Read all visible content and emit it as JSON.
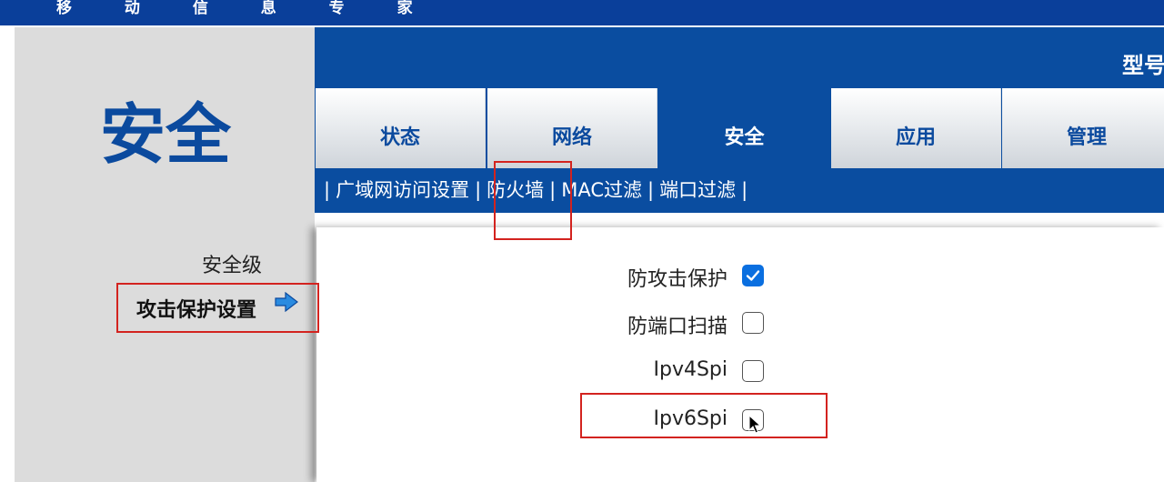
{
  "header": {
    "slogan": "移 动 信 息 专 家",
    "page_title": "安全",
    "model_label": "型号"
  },
  "tabs": [
    {
      "label": "状态",
      "active": false
    },
    {
      "label": "网络",
      "active": false
    },
    {
      "label": "安全",
      "active": true
    },
    {
      "label": "应用",
      "active": false
    },
    {
      "label": "管理",
      "active": false
    }
  ],
  "subnav": {
    "separator": "|",
    "items": [
      "广域网访问设置",
      "防火墙",
      "MAC过滤",
      "端口过滤"
    ],
    "active": "防火墙"
  },
  "sidebar": {
    "items": [
      {
        "label": "安全级",
        "active": false
      },
      {
        "label": "攻击保护设置",
        "active": true
      }
    ],
    "active_icon": "arrow-right-icon"
  },
  "form": {
    "options": [
      {
        "label": "防攻击保护",
        "checked": true
      },
      {
        "label": "防端口扫描",
        "checked": false
      },
      {
        "label": "Ipv4Spi",
        "checked": false
      },
      {
        "label": "Ipv6Spi",
        "checked": false
      }
    ]
  },
  "colors": {
    "brand_blue": "#0a4da0",
    "highlight_red": "#d3231f",
    "checkbox_blue": "#0a6fe0"
  }
}
